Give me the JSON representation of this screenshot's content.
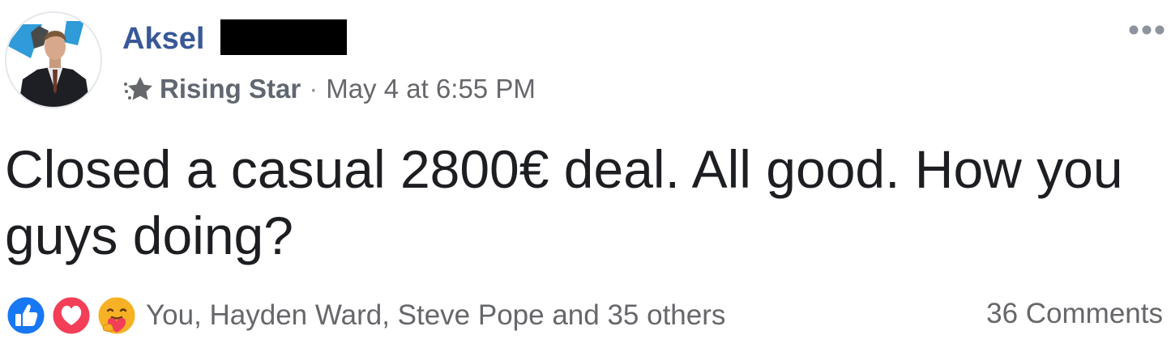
{
  "post": {
    "author": {
      "name": "Aksel"
    },
    "badge": {
      "label": "Rising Star",
      "icon": "rising-star-icon"
    },
    "separator": "·",
    "timestamp": "May 4 at 6:55 PM",
    "text": "Closed a casual 2800€ deal. All good. How you guys doing?",
    "more_options_icon": "ellipsis-icon"
  },
  "engagement": {
    "reactions": [
      "like-icon",
      "love-icon",
      "care-icon"
    ],
    "reaction_names": "You, Hayden Ward, Steve Pope and 35 others",
    "comments": "36 Comments"
  },
  "colors": {
    "author_name": "#385898",
    "meta_text": "#65676b",
    "body_text": "#1c1e21",
    "like_blue": "#1877f2",
    "love_red": "#f33e58",
    "care_yellow": "#f7b125",
    "redaction": "#000000"
  }
}
